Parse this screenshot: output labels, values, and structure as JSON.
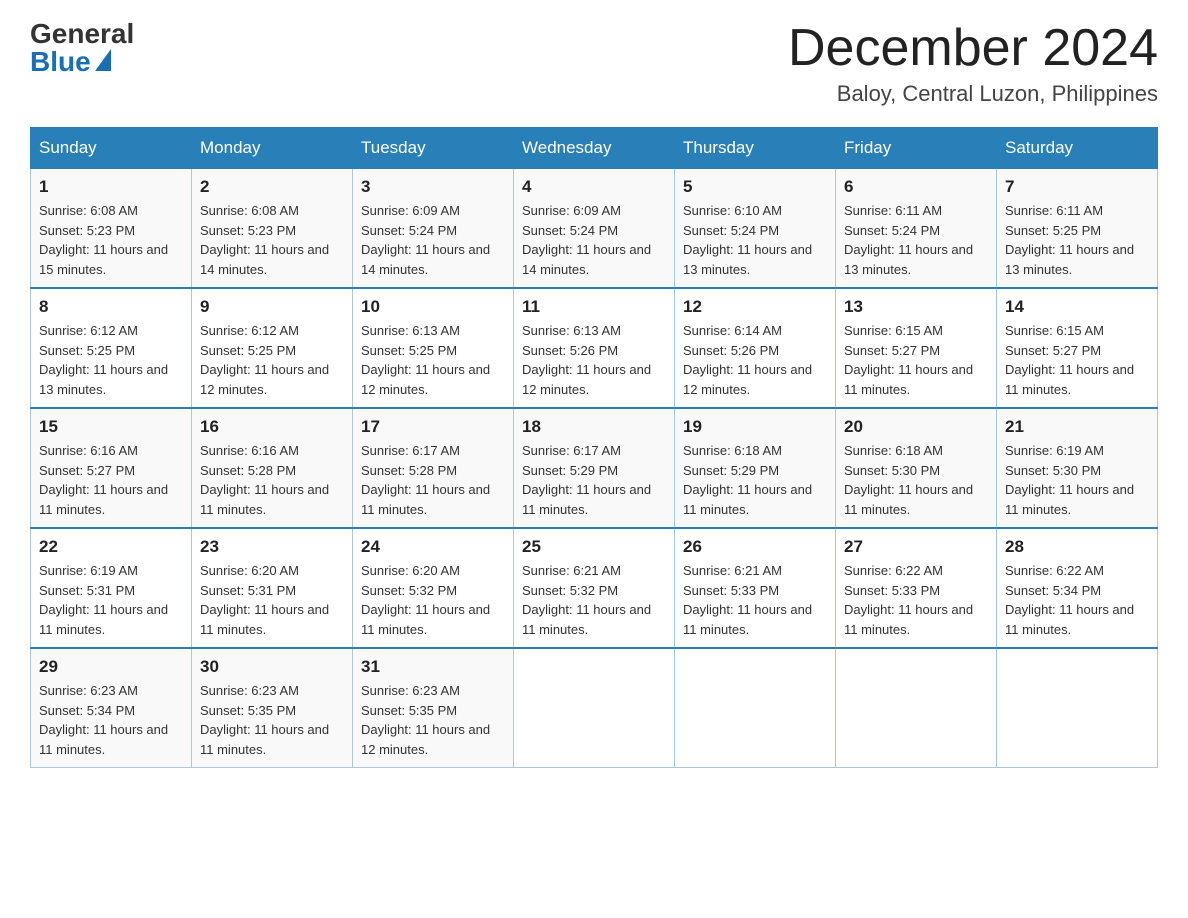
{
  "header": {
    "logo_general": "General",
    "logo_blue": "Blue",
    "month_year": "December 2024",
    "location": "Baloy, Central Luzon, Philippines"
  },
  "calendar": {
    "days_of_week": [
      "Sunday",
      "Monday",
      "Tuesday",
      "Wednesday",
      "Thursday",
      "Friday",
      "Saturday"
    ],
    "weeks": [
      [
        {
          "day": "1",
          "sunrise": "6:08 AM",
          "sunset": "5:23 PM",
          "daylight": "11 hours and 15 minutes."
        },
        {
          "day": "2",
          "sunrise": "6:08 AM",
          "sunset": "5:23 PM",
          "daylight": "11 hours and 14 minutes."
        },
        {
          "day": "3",
          "sunrise": "6:09 AM",
          "sunset": "5:24 PM",
          "daylight": "11 hours and 14 minutes."
        },
        {
          "day": "4",
          "sunrise": "6:09 AM",
          "sunset": "5:24 PM",
          "daylight": "11 hours and 14 minutes."
        },
        {
          "day": "5",
          "sunrise": "6:10 AM",
          "sunset": "5:24 PM",
          "daylight": "11 hours and 13 minutes."
        },
        {
          "day": "6",
          "sunrise": "6:11 AM",
          "sunset": "5:24 PM",
          "daylight": "11 hours and 13 minutes."
        },
        {
          "day": "7",
          "sunrise": "6:11 AM",
          "sunset": "5:25 PM",
          "daylight": "11 hours and 13 minutes."
        }
      ],
      [
        {
          "day": "8",
          "sunrise": "6:12 AM",
          "sunset": "5:25 PM",
          "daylight": "11 hours and 13 minutes."
        },
        {
          "day": "9",
          "sunrise": "6:12 AM",
          "sunset": "5:25 PM",
          "daylight": "11 hours and 12 minutes."
        },
        {
          "day": "10",
          "sunrise": "6:13 AM",
          "sunset": "5:25 PM",
          "daylight": "11 hours and 12 minutes."
        },
        {
          "day": "11",
          "sunrise": "6:13 AM",
          "sunset": "5:26 PM",
          "daylight": "11 hours and 12 minutes."
        },
        {
          "day": "12",
          "sunrise": "6:14 AM",
          "sunset": "5:26 PM",
          "daylight": "11 hours and 12 minutes."
        },
        {
          "day": "13",
          "sunrise": "6:15 AM",
          "sunset": "5:27 PM",
          "daylight": "11 hours and 11 minutes."
        },
        {
          "day": "14",
          "sunrise": "6:15 AM",
          "sunset": "5:27 PM",
          "daylight": "11 hours and 11 minutes."
        }
      ],
      [
        {
          "day": "15",
          "sunrise": "6:16 AM",
          "sunset": "5:27 PM",
          "daylight": "11 hours and 11 minutes."
        },
        {
          "day": "16",
          "sunrise": "6:16 AM",
          "sunset": "5:28 PM",
          "daylight": "11 hours and 11 minutes."
        },
        {
          "day": "17",
          "sunrise": "6:17 AM",
          "sunset": "5:28 PM",
          "daylight": "11 hours and 11 minutes."
        },
        {
          "day": "18",
          "sunrise": "6:17 AM",
          "sunset": "5:29 PM",
          "daylight": "11 hours and 11 minutes."
        },
        {
          "day": "19",
          "sunrise": "6:18 AM",
          "sunset": "5:29 PM",
          "daylight": "11 hours and 11 minutes."
        },
        {
          "day": "20",
          "sunrise": "6:18 AM",
          "sunset": "5:30 PM",
          "daylight": "11 hours and 11 minutes."
        },
        {
          "day": "21",
          "sunrise": "6:19 AM",
          "sunset": "5:30 PM",
          "daylight": "11 hours and 11 minutes."
        }
      ],
      [
        {
          "day": "22",
          "sunrise": "6:19 AM",
          "sunset": "5:31 PM",
          "daylight": "11 hours and 11 minutes."
        },
        {
          "day": "23",
          "sunrise": "6:20 AM",
          "sunset": "5:31 PM",
          "daylight": "11 hours and 11 minutes."
        },
        {
          "day": "24",
          "sunrise": "6:20 AM",
          "sunset": "5:32 PM",
          "daylight": "11 hours and 11 minutes."
        },
        {
          "day": "25",
          "sunrise": "6:21 AM",
          "sunset": "5:32 PM",
          "daylight": "11 hours and 11 minutes."
        },
        {
          "day": "26",
          "sunrise": "6:21 AM",
          "sunset": "5:33 PM",
          "daylight": "11 hours and 11 minutes."
        },
        {
          "day": "27",
          "sunrise": "6:22 AM",
          "sunset": "5:33 PM",
          "daylight": "11 hours and 11 minutes."
        },
        {
          "day": "28",
          "sunrise": "6:22 AM",
          "sunset": "5:34 PM",
          "daylight": "11 hours and 11 minutes."
        }
      ],
      [
        {
          "day": "29",
          "sunrise": "6:23 AM",
          "sunset": "5:34 PM",
          "daylight": "11 hours and 11 minutes."
        },
        {
          "day": "30",
          "sunrise": "6:23 AM",
          "sunset": "5:35 PM",
          "daylight": "11 hours and 11 minutes."
        },
        {
          "day": "31",
          "sunrise": "6:23 AM",
          "sunset": "5:35 PM",
          "daylight": "11 hours and 12 minutes."
        },
        null,
        null,
        null,
        null
      ]
    ]
  }
}
